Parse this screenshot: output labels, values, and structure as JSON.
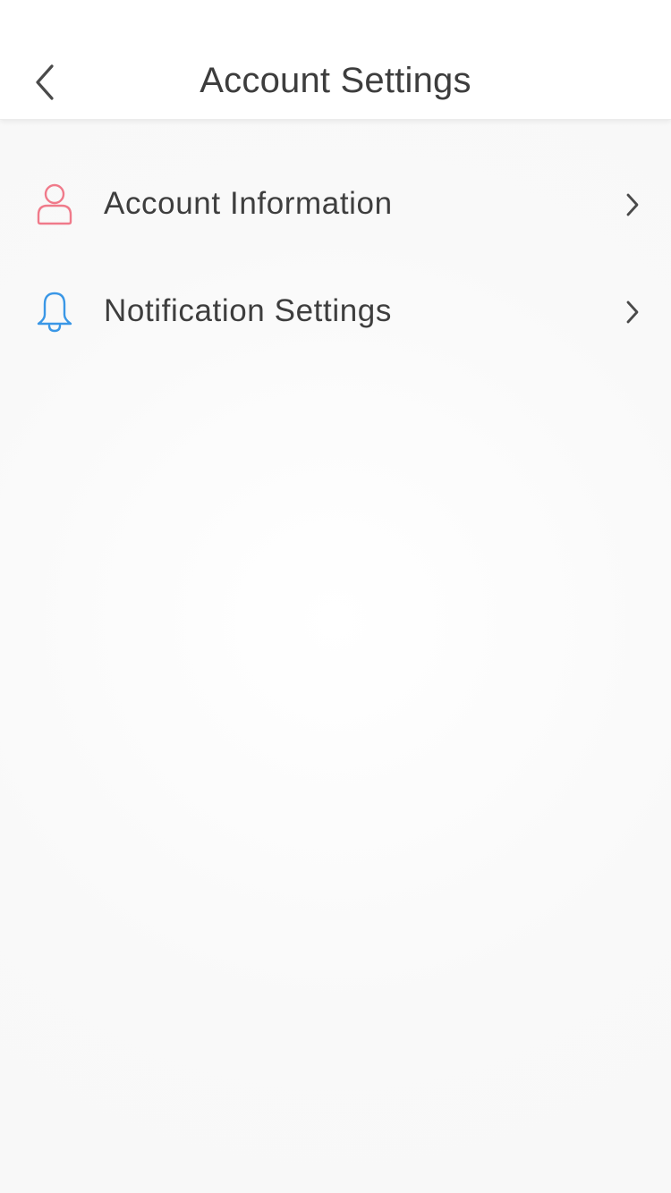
{
  "header": {
    "title": "Account Settings",
    "back_icon": "chevron-left-icon"
  },
  "menu": {
    "items": [
      {
        "label": "Account Information",
        "icon": "person-icon",
        "icon_color": "#f07a8a",
        "chevron_icon": "chevron-right-icon"
      },
      {
        "label": "Notification Settings",
        "icon": "bell-icon",
        "icon_color": "#3a97e6",
        "chevron_icon": "chevron-right-icon"
      }
    ]
  },
  "colors": {
    "header_bg": "#ffffff",
    "page_bg": "#f8f8f8",
    "text": "#3e3e3e"
  }
}
